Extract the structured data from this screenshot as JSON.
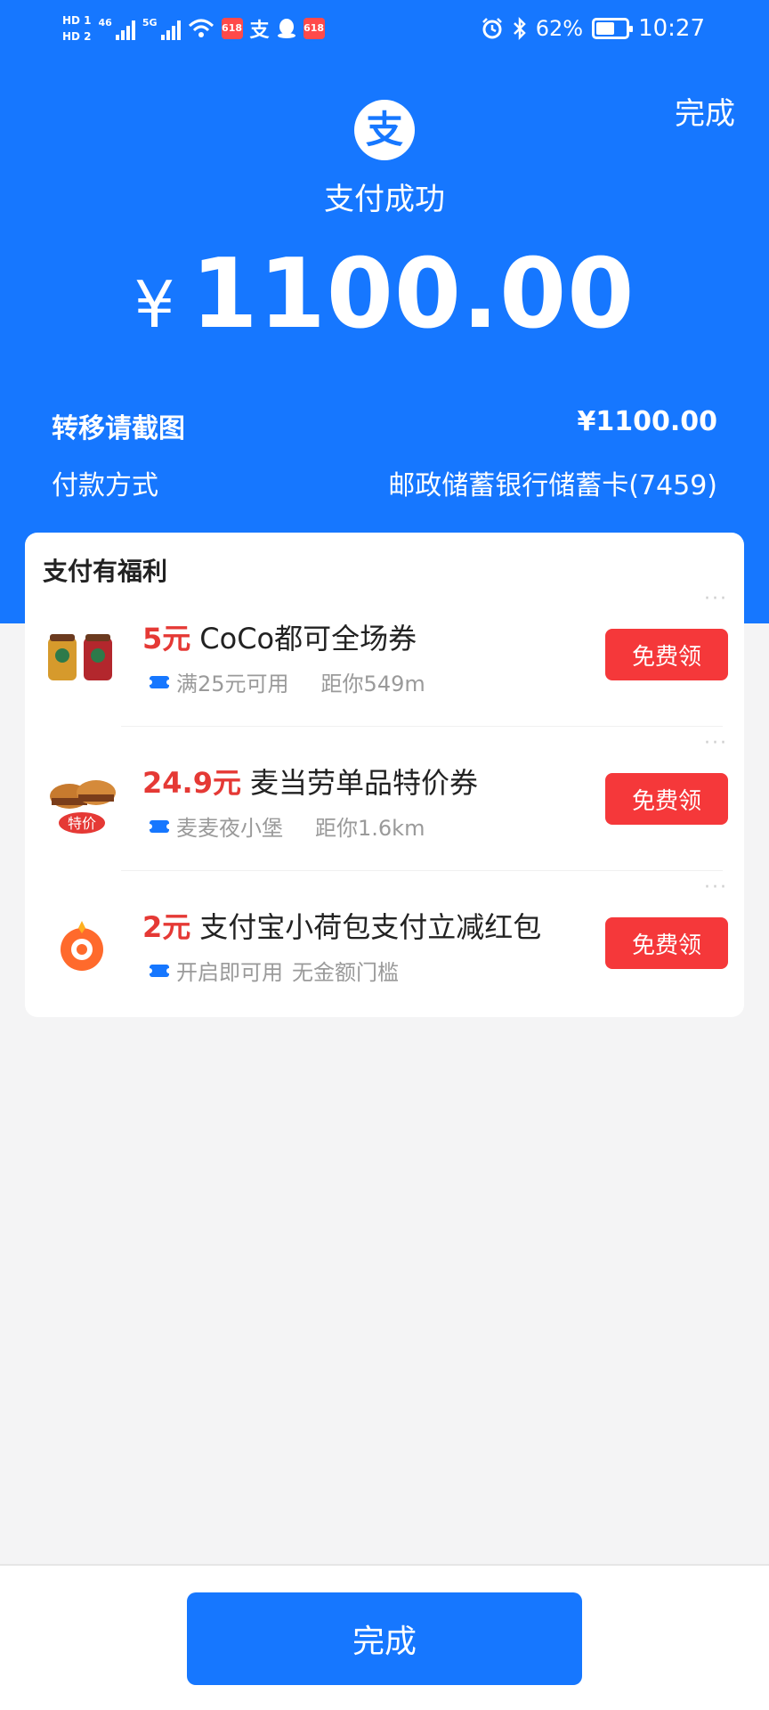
{
  "status_bar": {
    "hd1": "HD 1",
    "hd2": "HD 2",
    "sig1_label": "46",
    "sig2_label": "5G",
    "badge1": "618",
    "badge2": "618",
    "alipay_glyph": "支",
    "battery": "62%",
    "time": "10:27",
    "icons": [
      "signal-icon",
      "wifi-icon",
      "qq-icon",
      "alarm-icon",
      "bluetooth-icon",
      "battery-icon"
    ],
    "battery_level": 0.62
  },
  "header": {
    "done_label": "完成",
    "logo_glyph": "支",
    "title": "支付成功",
    "currency": "¥",
    "amount": "1100.00"
  },
  "info": {
    "row1_label": "转移请截图",
    "row1_value": "¥1100.00",
    "row2_label": "付款方式",
    "row2_value": "邮政储蓄银行储蓄卡(7459)"
  },
  "benefits": {
    "title": "支付有福利",
    "items": [
      {
        "price": "5元",
        "name": "CoCo都可全场券",
        "sub1": "满25元可用",
        "sub2": "距你549m",
        "button": "免费领",
        "more": "···"
      },
      {
        "price": "24.9元",
        "name": "麦当劳单品特价券",
        "sub1": "麦麦夜小堡",
        "sub2": "距你1.6km",
        "button": "免费领",
        "more": "···",
        "thumb_tag": "特价"
      },
      {
        "price": "2元",
        "name": "支付宝小荷包支付立减红包",
        "sub1": "开启即可用",
        "sub2": "无金额门槛",
        "button": "免费领",
        "more": "···"
      }
    ]
  },
  "footer": {
    "done_label": "完成"
  },
  "colors": {
    "primary": "#1677ff",
    "red": "#f5383a",
    "price_red": "#e53935",
    "background": "#f4f4f5"
  }
}
